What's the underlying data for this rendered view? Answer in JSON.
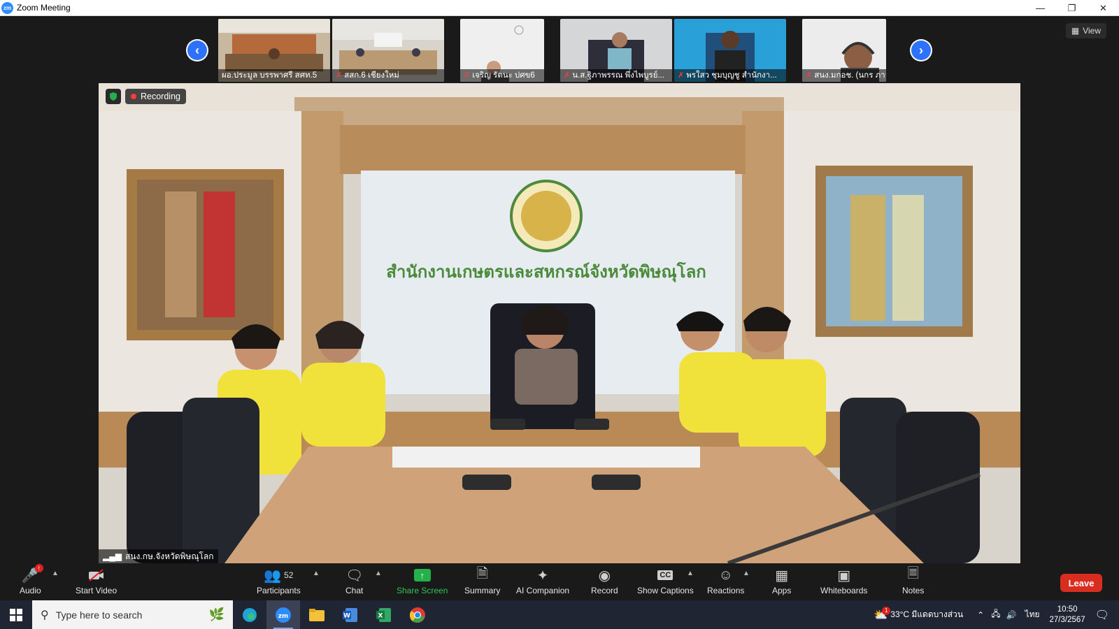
{
  "window": {
    "title": "Zoom Meeting",
    "logo": "zm"
  },
  "gallery": {
    "participants": [
      {
        "name": "ผอ.ประมูล บรรพาศรี สศท.5",
        "muted": false
      },
      {
        "name": "สสก.6 เชียงใหม่",
        "muted": true
      },
      {
        "name": "เจริญ รัตนะ ปศข6",
        "muted": true
      },
      {
        "name": "น.ส.ฐิภาพรรณ พึ่งไพบูรย์...",
        "muted": true
      },
      {
        "name": "พรใสว ชุมบุญชู สำนักงา...",
        "muted": true
      },
      {
        "name": "สนง.มกอช. (นกร ภาวรา...",
        "muted": true
      }
    ],
    "view_label": "View"
  },
  "main_video": {
    "recording_label": "Recording",
    "speaker_name": "สนง.กษ.จังหวัดพิษณุโลก",
    "banner_text": "สำนักงานเกษตรและสหกรณ์จังหวัดพิษณุโลก"
  },
  "toolbar": {
    "audio": "Audio",
    "start_video": "Start Video",
    "participants": "Participants",
    "participant_count": "52",
    "chat": "Chat",
    "share_screen": "Share Screen",
    "summary": "Summary",
    "ai_companion": "AI Companion",
    "record": "Record",
    "show_captions": "Show Captions",
    "reactions": "Reactions",
    "apps": "Apps",
    "whiteboards": "Whiteboards",
    "notes": "Notes",
    "leave": "Leave",
    "audio_badge": "!",
    "captions_glyph": "CC"
  },
  "taskbar": {
    "search_placeholder": "Type here to search",
    "weather": "33°C มีแดดบางส่วน",
    "language": "ไทย",
    "time": "10:50",
    "date": "27/3/2567",
    "weather_badge": "1"
  },
  "colors": {
    "accent_blue": "#2d8cff",
    "leave_red": "#d92d20",
    "share_green": "#24b04b",
    "shirt_yellow": "#f0e23a"
  }
}
